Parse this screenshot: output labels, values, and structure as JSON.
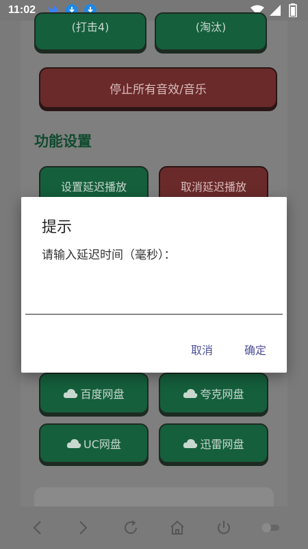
{
  "status_bar": {
    "time": "11:02",
    "notification_icons": [
      "bird-icon",
      "download-icon",
      "download-icon"
    ],
    "system_icons": [
      "wifi-icon",
      "signal-icon",
      "battery-icon"
    ]
  },
  "buttons": {
    "top_left_partial": "(打击4)",
    "top_right_partial": "(淘汰)",
    "stop_all": "停止所有音效/音乐",
    "set_delay": "设置延迟播放",
    "cancel_delay": "取消延迟播放",
    "baidu_pan": "百度网盘",
    "quark_pan": "夸克网盘",
    "uc_pan": "UC网盘",
    "xunlei_pan": "迅雷网盘"
  },
  "section": {
    "function_settings": "功能设置"
  },
  "dialog": {
    "title": "提示",
    "message": "请输入延迟时间（毫秒）：",
    "input_value": "",
    "cancel_label": "取消",
    "confirm_label": "确定"
  },
  "colors": {
    "green_button": "#155f3c",
    "red_button": "#6b2a2a",
    "dialog_action": "#4d4f9b"
  }
}
